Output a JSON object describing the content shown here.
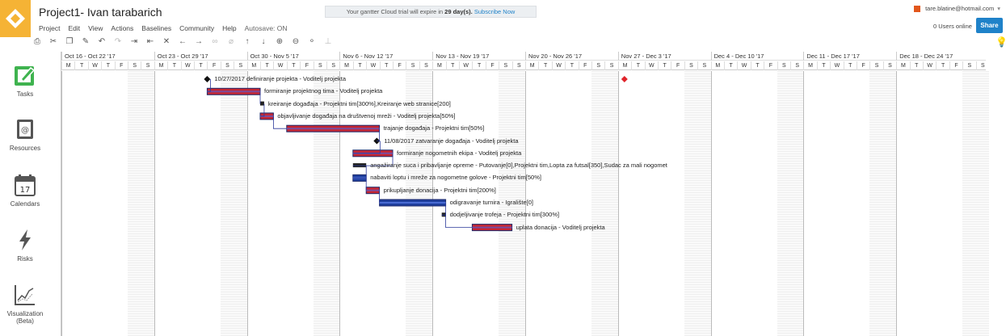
{
  "app": {
    "title": "Project1- Ivan tarabarich",
    "menu": [
      "Project",
      "Edit",
      "View",
      "Actions",
      "Baselines",
      "Community",
      "Help"
    ],
    "autosave": "Autosave: ON"
  },
  "trial": {
    "prefix": "Your gantter Cloud trial will expire in",
    "days": "29 day(s).",
    "subscribe": "Subscribe Now"
  },
  "user": {
    "email": "tare.blatine@hotmail.com",
    "online": "0 Users online",
    "share": "Share"
  },
  "toolbar": {
    "icons": [
      "print-icon",
      "cut-icon",
      "copy-icon",
      "format-paint-icon",
      "undo-icon",
      "redo-icon",
      "indent-icon",
      "outdent-icon",
      "delete-icon",
      "move-left-icon",
      "move-right-icon",
      "link-icon",
      "unlink-icon",
      "move-up-icon",
      "move-down-icon",
      "zoom-in-icon",
      "zoom-out-icon",
      "split-icon",
      "critical-path-icon",
      "lightbulb-icon"
    ]
  },
  "sidebar": {
    "items": [
      {
        "label": "Tasks",
        "icon": "tasks-icon"
      },
      {
        "label": "Resources",
        "icon": "resources-icon"
      },
      {
        "label": "Calendars",
        "icon": "calendar-icon",
        "badge": "17"
      },
      {
        "label": "Risks",
        "icon": "risks-icon"
      },
      {
        "label": "Visualization",
        "sub": "(Beta)",
        "icon": "visualization-icon"
      }
    ]
  },
  "gantt": {
    "weeks": [
      "Oct 16 - Oct 22 '17",
      "Oct 23 - Oct 29 '17",
      "Oct 30 - Nov 5 '17",
      "Nov 6 - Nov 12 '17",
      "Nov 13 - Nov 19 '17",
      "Nov 20 - Nov 26 '17",
      "Nov 27 - Dec 3 '17",
      "Dec 4 - Dec 10 '17",
      "Dec 11 - Dec 17 '17",
      "Dec 18 - Dec 24 '17"
    ],
    "day_letters": [
      "M",
      "T",
      "W",
      "T",
      "F",
      "S",
      "S"
    ],
    "tasks": [
      {
        "label": "10/27/2017 definiranje projekta - Voditelj projekta",
        "type": "milestone",
        "start": 11,
        "dur": 0
      },
      {
        "label": "formiranje projektnog tima - Voditelj projekta",
        "type": "task",
        "start": 11,
        "dur": 4
      },
      {
        "label": "kreiranje događaja - Projektni tim[300%],Kreiranje web stranice[200]",
        "type": "summary",
        "start": 15,
        "dur": 0.3
      },
      {
        "label": "objavljivanje događaja na društvenoj mreži - Voditelj projekta[50%]",
        "type": "task",
        "start": 15,
        "dur": 1
      },
      {
        "label": "trajanje događaja - Projektni tim[50%]",
        "type": "task",
        "start": 17,
        "dur": 7
      },
      {
        "label": "11/08/2017 zatvaranje događaja - Voditelj projekta",
        "type": "milestone",
        "start": 23.8,
        "dur": 0
      },
      {
        "label": "formiranje nogometnih ekipa - Voditelj projekta",
        "type": "task",
        "start": 22,
        "dur": 3
      },
      {
        "label": "angažiranje suca i pribavljanje opreme - Putovanje[0],Projektni tim,Lopta za futsal[350],Sudac za mali nogomet",
        "type": "summary",
        "start": 22,
        "dur": 1
      },
      {
        "label": "nabaviti loptu i mreže za nogometne golove - Projektni tim[50%]",
        "type": "task-blue",
        "start": 22,
        "dur": 1
      },
      {
        "label": "prikupljanje donacija - Projektni tim[200%]",
        "type": "task",
        "start": 23,
        "dur": 1
      },
      {
        "label": "odigravanje turnira - Igralište[0]",
        "type": "task-blue",
        "start": 24,
        "dur": 5
      },
      {
        "label": "dodjeljivanje trofeja - Projektni tim[300%]",
        "type": "summary",
        "start": 28.7,
        "dur": 0.3
      },
      {
        "label": "uplata donacija - Voditelj projekta",
        "type": "task",
        "start": 31,
        "dur": 3
      }
    ],
    "marker": {
      "label": "Nov 27 red marker",
      "color": "#e0242b",
      "day": 42
    }
  },
  "colors": {
    "brand": "#f5b335",
    "accent": "#1f82c9",
    "bar_red": "#c62733",
    "bar_blue": "#1f3f9e",
    "tasks_green": "#3fb34f"
  }
}
